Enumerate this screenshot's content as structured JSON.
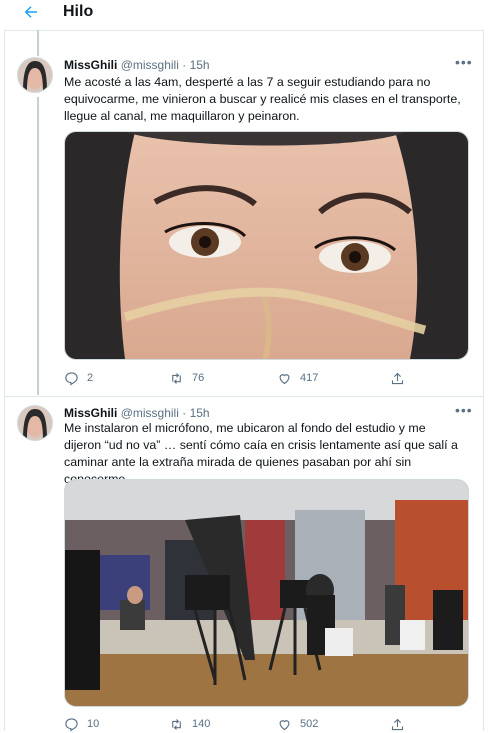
{
  "header": {
    "title": "Hilo"
  },
  "tweets": [
    {
      "display_name": "MissGhili",
      "handle": "@missghili",
      "separator": "·",
      "time": "15h",
      "text": "Me acosté a las 4am, desperté a las 7 a seguir estudiando para no equivocarme, me vinieron a buscar y realicé mis clases en el transporte, llegue al canal, me maquillaron y peinaron.",
      "replies": "2",
      "retweets": "76",
      "likes": "417"
    },
    {
      "display_name": "MissGhili",
      "handle": "@missghili",
      "separator": "·",
      "time": "15h",
      "text": "Me instalaron el micrófono, me ubicaron al fondo del estudio y me dijeron “ud no va” … sentí cómo caía en crisis lentamente así que salí a caminar ante la extraña mirada de quienes pasaban por ahí sin conocerme",
      "replies": "10",
      "retweets": "140",
      "likes": "502"
    }
  ],
  "colors": {
    "accent": "#1da1f2",
    "secondary_text": "#5b7083",
    "divider": "#e1e8ed"
  }
}
